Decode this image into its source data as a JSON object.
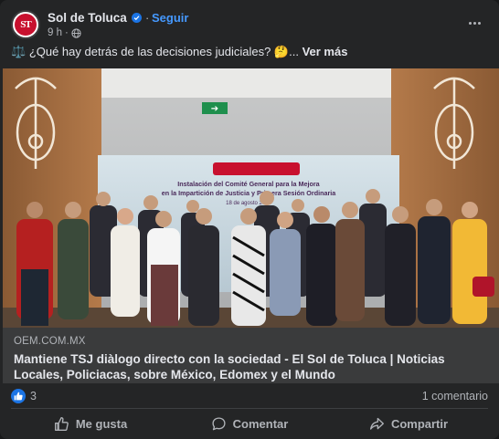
{
  "post": {
    "page_name": "Sol de Toluca",
    "avatar_initials": "ST",
    "follow_label": "Seguir",
    "separator": "·",
    "time": "9 h",
    "meta_separator": "·",
    "caption_icon": "⚖️",
    "caption_text": "¿Qué hay detrás de las decisiones judiciales? 🤔...",
    "see_more": "Ver más"
  },
  "photo": {
    "banner_line1": "Instalación del Comité General para la Mejora",
    "banner_line2": "en la Impartición de Justicia y Primera Sesión Ordinaria",
    "banner_date": "18 de agosto 2025",
    "exit_sign": "➔"
  },
  "link_preview": {
    "domain": "OEM.COM.MX",
    "title": "Mantiene TSJ diàlogo directo con la sociedad - El Sol de Toluca | Noticias Locales, Policiacas, sobre México, Edomex y el Mundo"
  },
  "reactions": {
    "count": "3",
    "comments": "1 comentario"
  },
  "actions": {
    "like": "Me gusta",
    "comment": "Comentar",
    "share": "Compartir"
  },
  "icons": {
    "verified": "verified-badge-icon",
    "globe": "globe-icon",
    "more": "more-options-icon",
    "like": "thumbs-up-icon",
    "comment": "comment-bubble-icon",
    "share": "share-arrow-icon"
  },
  "colors": {
    "background": "#242526",
    "accent": "#4599ff",
    "like_blue": "#1b74e4",
    "text_primary": "#e4e6eb",
    "text_secondary": "#b0b3b8",
    "link_bg": "#3a3b3c"
  }
}
